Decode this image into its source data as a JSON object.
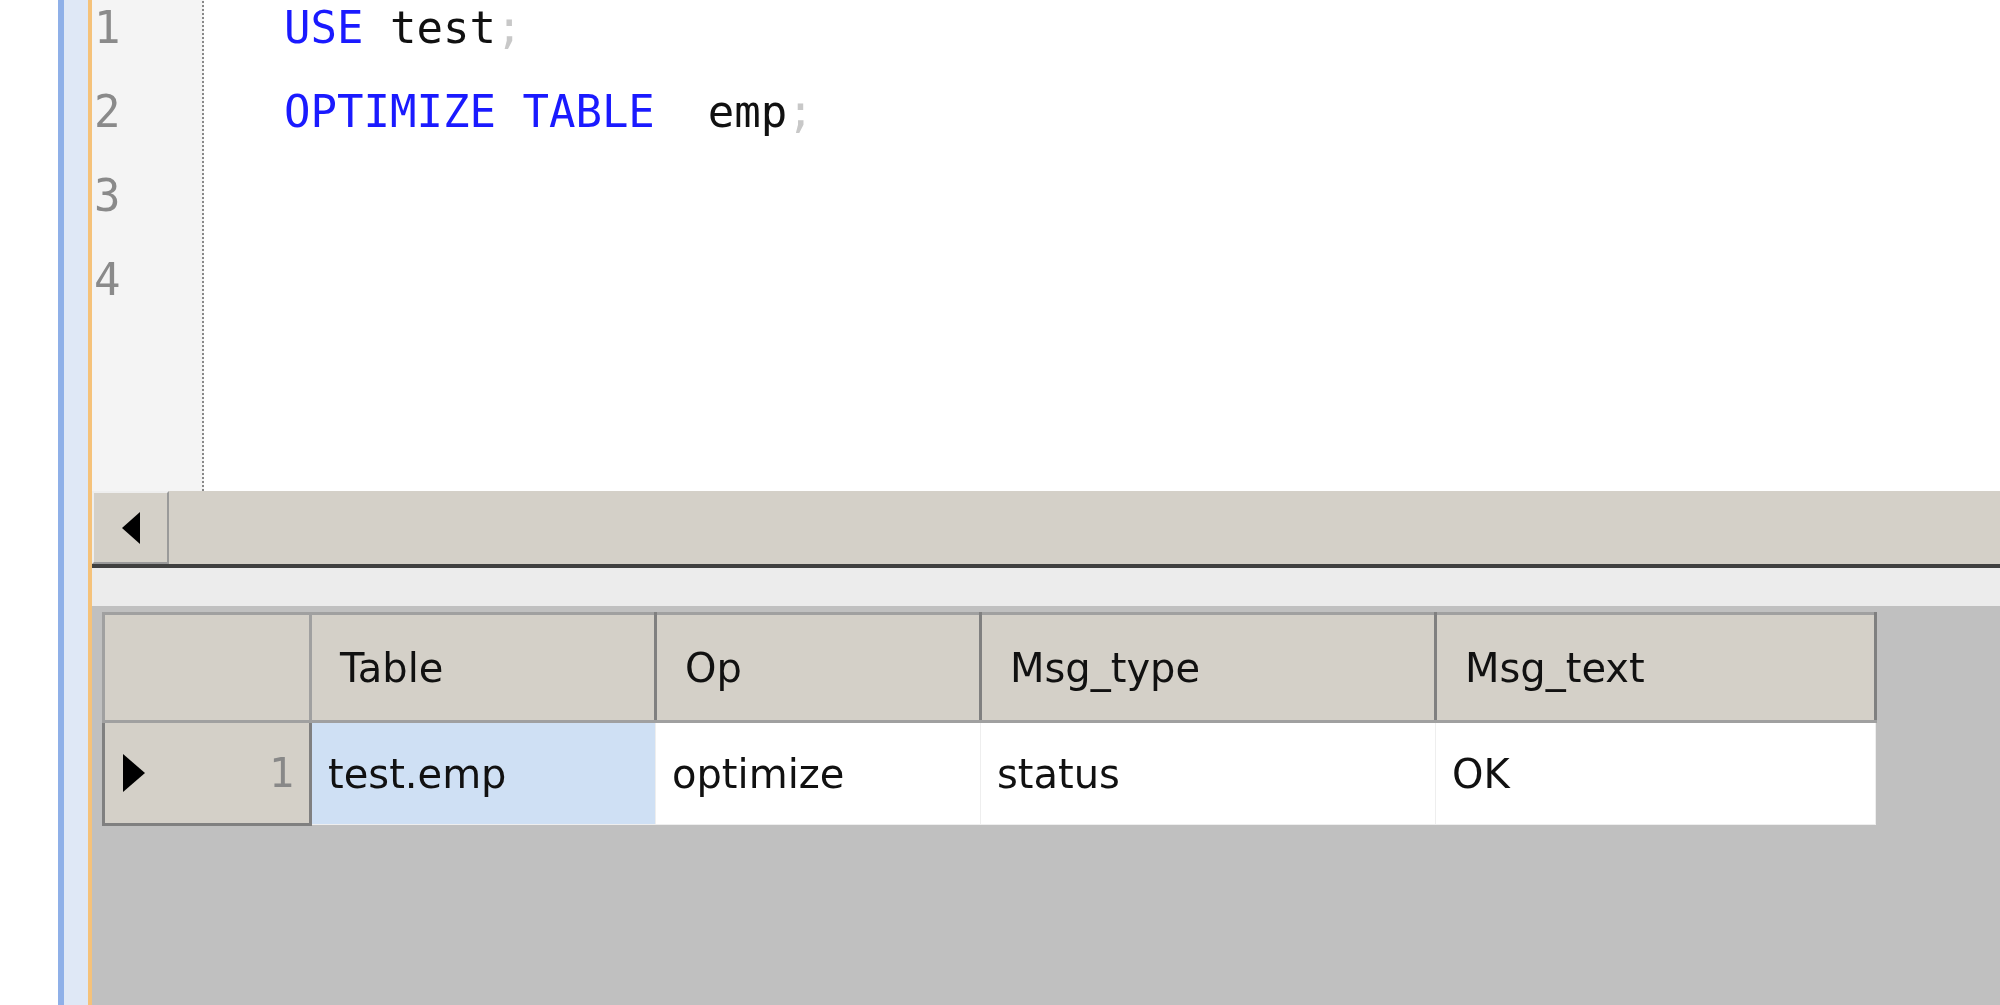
{
  "editor": {
    "lines": [
      {
        "number": "1",
        "tokens": [
          {
            "kind": "keyword",
            "text": "USE"
          },
          {
            "kind": "plain",
            "text": " test"
          },
          {
            "kind": "punct",
            "text": ";"
          }
        ]
      },
      {
        "number": "2",
        "tokens": [
          {
            "kind": "keyword",
            "text": "OPTIMIZE TABLE"
          },
          {
            "kind": "plain",
            "text": "  emp"
          },
          {
            "kind": "punct",
            "text": ";"
          }
        ]
      },
      {
        "number": "3"
      },
      {
        "number": "4"
      }
    ]
  },
  "results": {
    "columns": [
      "Table",
      "Op",
      "Msg_type",
      "Msg_text"
    ],
    "rows": [
      {
        "number": "1",
        "current": true,
        "cells": [
          {
            "text": "test.emp",
            "selected": true
          },
          {
            "text": "optimize",
            "selected": false
          },
          {
            "text": "status",
            "selected": false
          },
          {
            "text": "OK",
            "selected": false
          }
        ]
      }
    ]
  }
}
